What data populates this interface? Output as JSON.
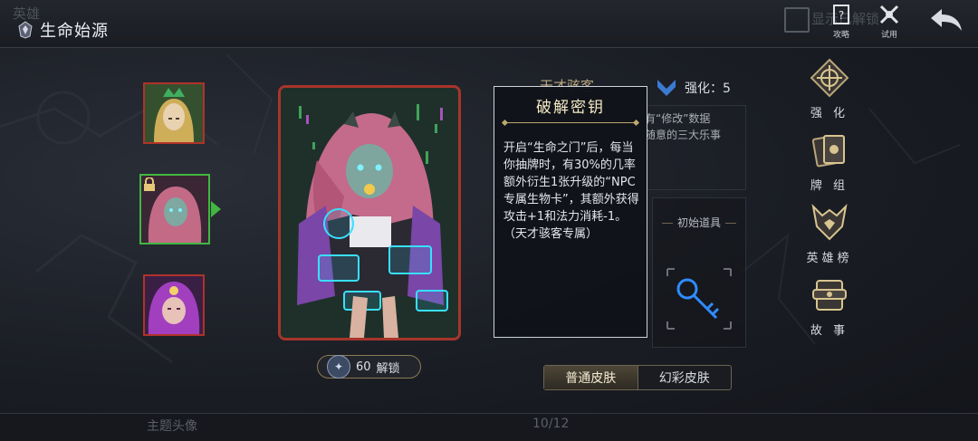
{
  "header": {
    "ghost_title": "英雄",
    "title": "生命始源",
    "ghost_checkbox_label": "显示已解锁",
    "buttons": [
      {
        "label": "攻略",
        "icon": "guide-book-icon"
      },
      {
        "label": "试用",
        "icon": "trial-swords-icon"
      }
    ],
    "back_icon": "back-arrow-icon"
  },
  "heroes": [
    {
      "name": "green-crowned-hero",
      "state": "normal"
    },
    {
      "name": "pink-hair-hacker",
      "state": "selected",
      "locked": true
    },
    {
      "name": "purple-hair-hero",
      "state": "normal"
    }
  ],
  "card": {
    "unlock_cost": "60",
    "unlock_label": "解锁",
    "unlock_icon": "feather-currency-icon"
  },
  "hero_info": {
    "name_partial": "天才骇客",
    "upgrade_label": "强化：5",
    "description_partial": [
      "有“修改”数据",
      "随意的三大乐事"
    ],
    "starting_item_label": "初始道具",
    "starting_item_icon": "key-icon"
  },
  "tooltip": {
    "title": "破解密钥",
    "body": "开启“生命之门”后，每当你抽牌时，有30%的几率额外衍生1张升级的“NPC专属生物卡”，其额外获得攻击+1和法力消耗-1。（天才骇客专属）"
  },
  "skins": {
    "tabs": [
      {
        "label": "普通皮肤",
        "active": true
      },
      {
        "label": "幻彩皮肤",
        "active": false
      }
    ]
  },
  "side_menu": [
    {
      "label": "强 化",
      "icon": "compass-emblem-icon"
    },
    {
      "label": "牌 组",
      "icon": "card-deck-icon"
    },
    {
      "label": "英雄榜",
      "icon": "horned-crest-icon"
    },
    {
      "label": "故 事",
      "icon": "scroll-icon"
    }
  ],
  "bottom": {
    "ghost_left": "主题头像",
    "page_indicator": "10/12"
  },
  "colors": {
    "selected_border": "#41b741",
    "card_border": "#a7352b",
    "gold_accent": "#bda86e"
  }
}
